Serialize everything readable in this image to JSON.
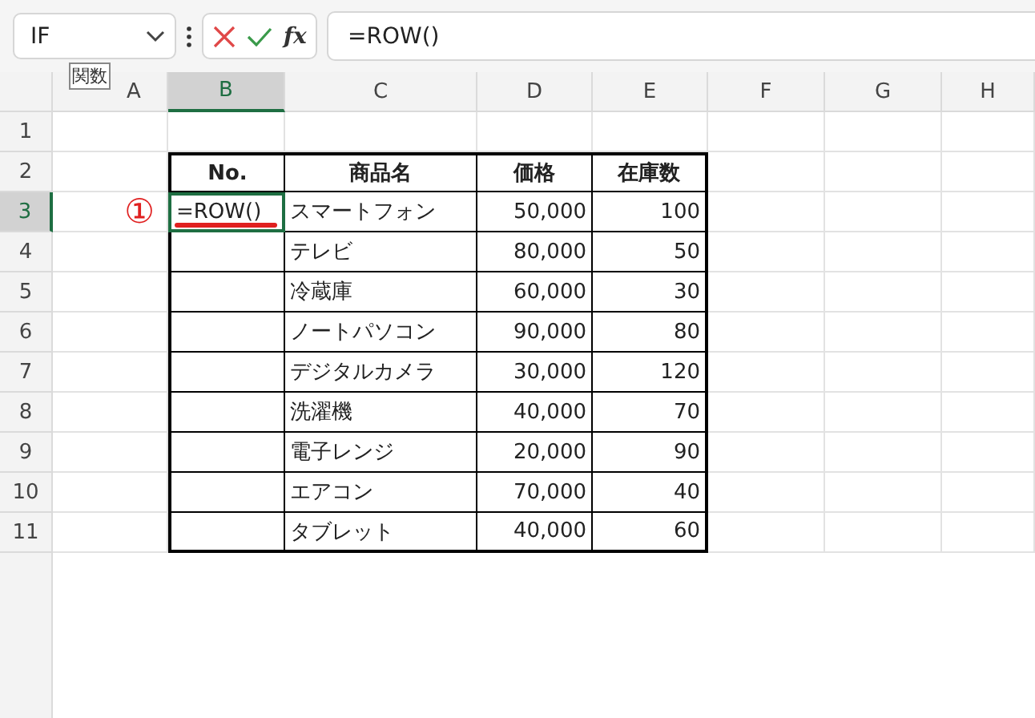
{
  "formula_bar": {
    "name_box": "IF",
    "function_label": "fx",
    "value": "=ROW()"
  },
  "tooltip": "関数",
  "columns": [
    {
      "label": "A",
      "selected": false
    },
    {
      "label": "B",
      "selected": true
    },
    {
      "label": "C",
      "selected": false
    },
    {
      "label": "D",
      "selected": false
    },
    {
      "label": "E",
      "selected": false
    },
    {
      "label": "F",
      "selected": false
    },
    {
      "label": "G",
      "selected": false
    },
    {
      "label": "H",
      "selected": false
    }
  ],
  "row_headers": [
    {
      "label": "1",
      "selected": false
    },
    {
      "label": "2",
      "selected": false
    },
    {
      "label": "3",
      "selected": true
    },
    {
      "label": "4",
      "selected": false
    },
    {
      "label": "5",
      "selected": false
    },
    {
      "label": "6",
      "selected": false
    },
    {
      "label": "7",
      "selected": false
    },
    {
      "label": "8",
      "selected": false
    },
    {
      "label": "9",
      "selected": false
    },
    {
      "label": "10",
      "selected": false
    },
    {
      "label": "11",
      "selected": false
    }
  ],
  "table": {
    "header": [
      "No.",
      "商品名",
      "価格",
      "在庫数"
    ],
    "rows": [
      {
        "no": "=ROW()",
        "product": "スマートフォン",
        "price": "50,000",
        "stock": "100"
      },
      {
        "product": "テレビ",
        "price": "80,000",
        "stock": "50"
      },
      {
        "product": "冷蔵庫",
        "price": "60,000",
        "stock": "30"
      },
      {
        "product": "ノートパソコン",
        "price": "90,000",
        "stock": "80"
      },
      {
        "product": "デジタルカメラ",
        "price": "30,000",
        "stock": "120"
      },
      {
        "product": "洗濯機",
        "price": "40,000",
        "stock": "70"
      },
      {
        "product": "電子レンジ",
        "price": "20,000",
        "stock": "90"
      },
      {
        "product": "エアコン",
        "price": "70,000",
        "stock": "40"
      },
      {
        "product": "タブレット",
        "price": "40,000",
        "stock": "60"
      }
    ]
  },
  "annotation": {
    "marker": "①",
    "underline": true
  }
}
